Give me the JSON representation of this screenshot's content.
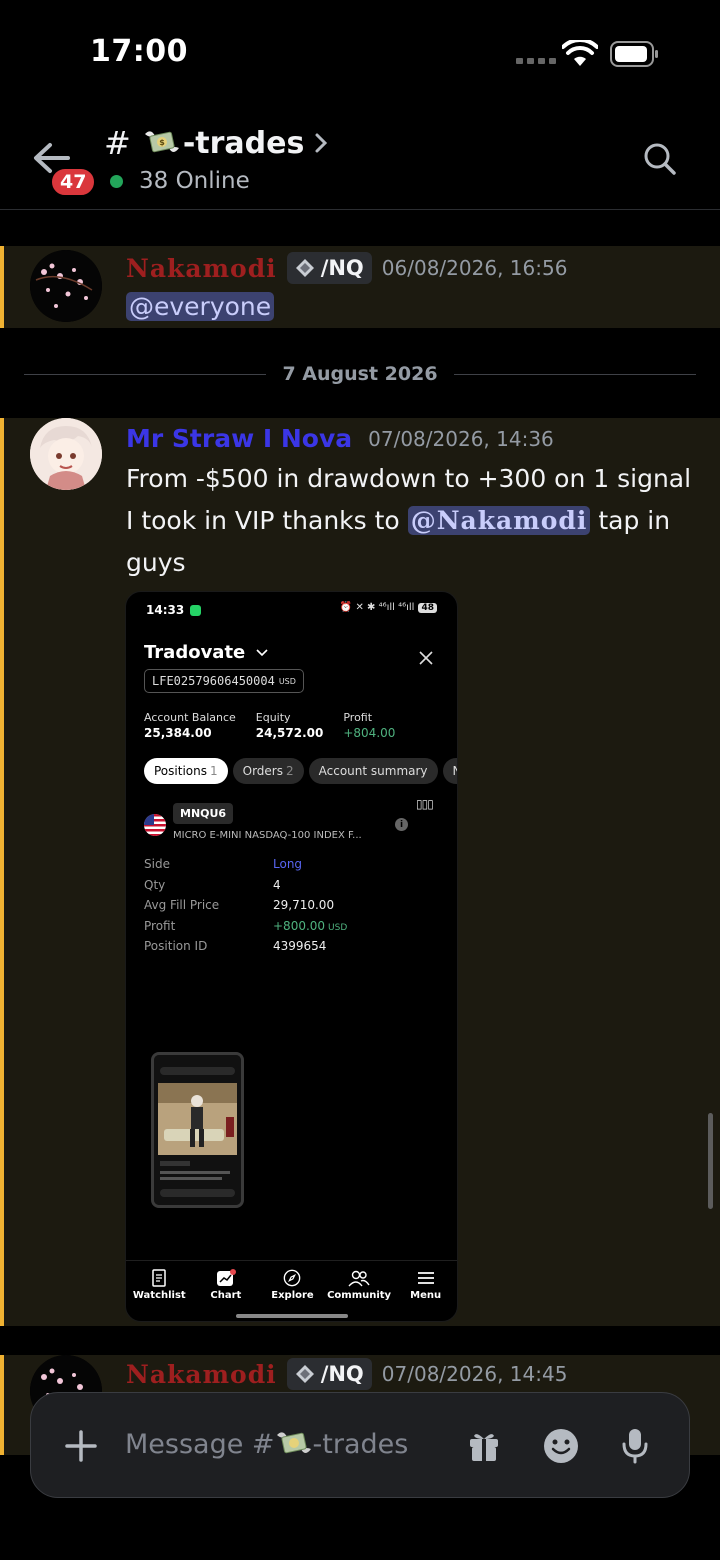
{
  "status_bar": {
    "time": "17:00"
  },
  "header": {
    "unread_count": "47",
    "hash": "#",
    "channel_name": "-trades",
    "online_text": "38 Online"
  },
  "messages": [
    {
      "author": "Nakamodi",
      "role_tag": "/NQ",
      "timestamp": "06/08/2026, 16:56",
      "mention": "@everyone"
    },
    {
      "author": "Mr Straw I Nova",
      "timestamp": "07/08/2026, 14:36",
      "text_before": "From -$500 in drawdown to +300 on 1 signal I took in VIP thanks to ",
      "mention": "@Nakamodi",
      "text_after": " tap in guys"
    },
    {
      "author": "Nakamodi",
      "role_tag": "/NQ",
      "timestamp": "07/08/2026, 14:45"
    }
  ],
  "date_divider": "7 August 2026",
  "embedded_screenshot": {
    "time": "14:33",
    "status_right": "⏰ ✕ ✱ ⁴⁶ıll ⁴⁶ıll",
    "battery": "48",
    "broker": "Tradovate",
    "account_id": "LFE02579606450004",
    "account_currency": "USD",
    "stats": [
      {
        "label": "Account Balance",
        "value": "25,384.00"
      },
      {
        "label": "Equity",
        "value": "24,572.00"
      },
      {
        "label": "Profit",
        "value": "+804.00"
      }
    ],
    "tabs": [
      {
        "label": "Positions",
        "count": "1"
      },
      {
        "label": "Orders",
        "count": "2"
      },
      {
        "label": "Account summary",
        "count": ""
      },
      {
        "label": "N",
        "count": ""
      }
    ],
    "symbol": "MNQU6",
    "symbol_desc": "MICRO E-MINI NASDAQ-100 INDEX F...",
    "details": {
      "side_label": "Side",
      "side_value": "Long",
      "qty_label": "Qty",
      "qty_value": "4",
      "avg_label": "Avg Fill Price",
      "avg_value": "29,710.00",
      "profit_label": "Profit",
      "profit_value": "+800.00",
      "profit_currency": "USD",
      "pos_label": "Position ID",
      "pos_value": "4399654"
    },
    "nav": [
      "Watchlist",
      "Chart",
      "Explore",
      "Community",
      "Menu"
    ]
  },
  "composer": {
    "placeholder_prefix": "Message #",
    "placeholder_channel": "-trades"
  },
  "colors": {
    "accent_bar": "#f0b232",
    "author_red": "#9e1f1f",
    "author_blue": "#3b36e6",
    "online": "#23a55a",
    "badge": "#da373c"
  }
}
